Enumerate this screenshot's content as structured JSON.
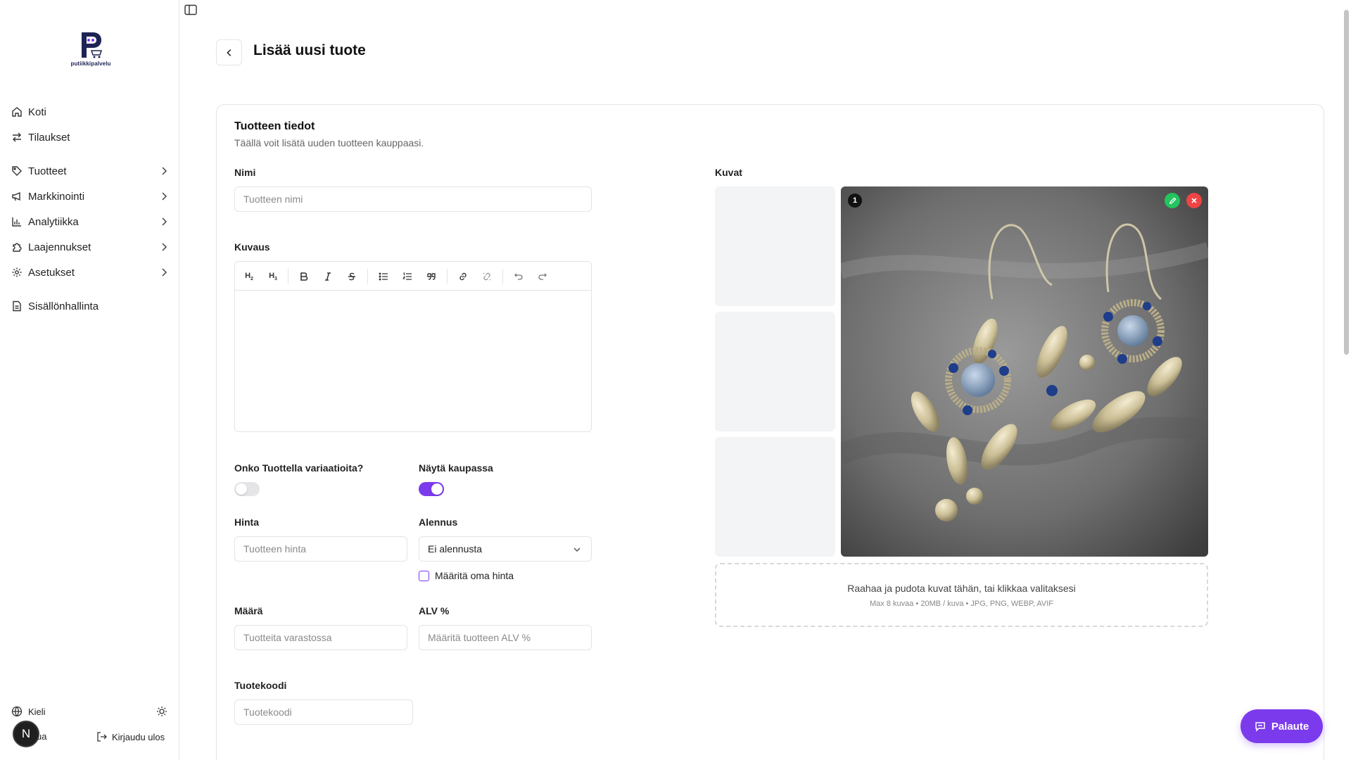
{
  "app": {
    "brand": "putiikkipalvelu"
  },
  "sidebar": {
    "items": [
      {
        "label": "Koti",
        "icon": "home-icon"
      },
      {
        "label": "Tilaukset",
        "icon": "arrows-icon"
      },
      {
        "label": "Tuotteet",
        "icon": "tag-icon"
      },
      {
        "label": "Markkinointi",
        "icon": "megaphone-icon"
      },
      {
        "label": "Analytiikka",
        "icon": "chart-icon"
      },
      {
        "label": "Laajennukset",
        "icon": "puzzle-icon"
      },
      {
        "label": "Asetukset",
        "icon": "gear-icon"
      },
      {
        "label": "Sisällönhallinta",
        "icon": "document-icon"
      }
    ],
    "footer": {
      "language": "Kieli",
      "account_partial": "ua",
      "logout": "Kirjaudu ulos",
      "avatar_initial": "N"
    }
  },
  "header": {
    "title": "Lisää uusi tuote"
  },
  "card": {
    "title": "Tuotteen tiedot",
    "subtitle": "Täällä voit lisätä uuden tuotteen kauppaasi."
  },
  "form": {
    "name_label": "Nimi",
    "name_placeholder": "Tuotteen nimi",
    "desc_label": "Kuvaus",
    "toolbar": {
      "h2": "H2",
      "h3": "H3"
    },
    "variations_label": "Onko Tuottella variaatioita?",
    "variations_on": false,
    "show_label": "Näytä kaupassa",
    "show_on": true,
    "price_label": "Hinta",
    "price_placeholder": "Tuotteen hinta",
    "discount_label": "Alennus",
    "discount_value": "Ei alennusta",
    "custom_price_label": "Määritä oma hinta",
    "quantity_label": "Määrä",
    "quantity_placeholder": "Tuotteita varastossa",
    "vat_label": "ALV %",
    "vat_placeholder": "Määritä tuotteen ALV %",
    "sku_label": "Tuotekoodi",
    "sku_placeholder": "Tuotekoodi"
  },
  "images": {
    "label": "Kuvat",
    "main_index": "1",
    "dropzone_text": "Raahaa ja pudota kuvat tähän, tai klikkaa valitaksesi",
    "dropzone_hint": "Max 8 kuvaa • 20MB / kuva • JPG, PNG, WEBP, AVIF"
  },
  "feedback": {
    "label": "Palaute"
  },
  "colors": {
    "accent": "#7c3aed",
    "edit": "#22c55e",
    "delete": "#ef4444"
  }
}
